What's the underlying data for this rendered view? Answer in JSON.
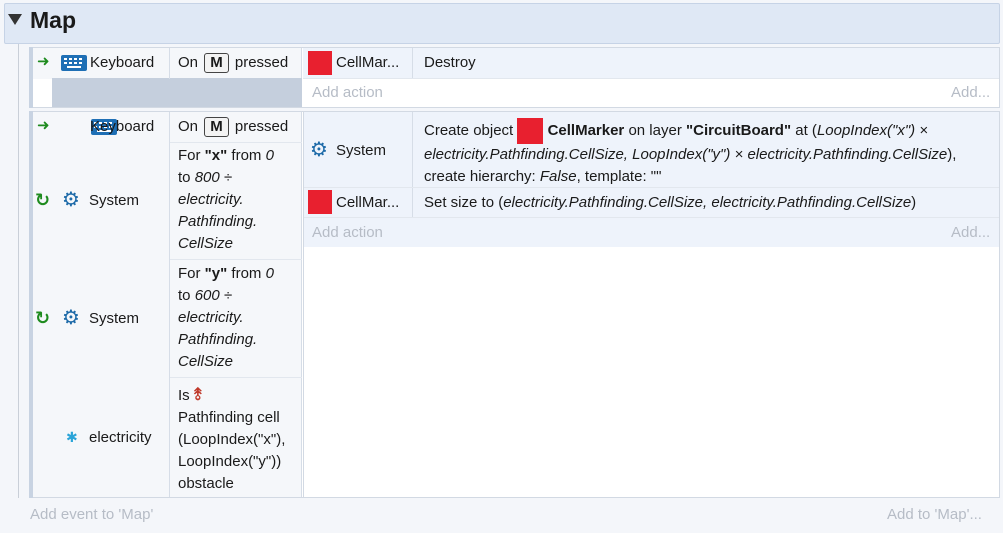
{
  "group": {
    "title": "Map"
  },
  "event1": {
    "condition": {
      "object": "Keyboard",
      "text_on": "On",
      "key": "M",
      "text_pressed": "pressed"
    },
    "action": {
      "object": "CellMar...",
      "text": "Destroy"
    },
    "add_action": "Add action",
    "add_more": "Add..."
  },
  "event2": {
    "condition": {
      "object": "Keyboard",
      "text_on": "On",
      "key": "M",
      "text_pressed": "pressed"
    },
    "action1": {
      "object": "System",
      "p1": "Create object",
      "obj_name": "CellMarker",
      "p2": "on layer",
      "layer": "\"CircuitBoard\"",
      "p3": "at (",
      "expr1": "LoopIndex(\"x\") × electricity.Pathfinding.CellSize, LoopIndex(\"y\") × electricity.Pathfinding.CellSize",
      "p4": "),",
      "p5": "create hierarchy:",
      "hier": "False",
      "p6": ", template: \"\""
    },
    "action2": {
      "object": "CellMar...",
      "p1": "Set size to (",
      "expr": "electricity.Pathfinding.CellSize, electricity.Pathfinding.CellSize",
      "p2": ")"
    },
    "add_action": "Add action",
    "add_more": "Add..."
  },
  "sub1": {
    "object": "System",
    "l1a": "For",
    "var": "\"x\"",
    "l1b": "from",
    "from": "0",
    "l2a": "to",
    "to": "800 ÷",
    "l3": "electricity.",
    "l4": "Pathfinding.",
    "l5": "CellSize"
  },
  "sub2": {
    "object": "System",
    "l1a": "For",
    "var": "\"y\"",
    "l1b": "from",
    "from": "0",
    "l2a": "to",
    "to": "600 ÷",
    "l3": "electricity.",
    "l4": "Pathfinding.",
    "l5": "CellSize"
  },
  "sub3": {
    "object": "electricity",
    "l1": "Is",
    "l2": "Pathfinding cell",
    "l3": "(LoopIndex(\"x\"),",
    "l4": "LoopIndex(\"y\"))",
    "l5": "obstacle"
  },
  "footer": {
    "add_event": "Add event to 'Map'",
    "add_to": "Add to 'Map'..."
  },
  "colors": {
    "accent_green": "#1e8b1e",
    "accent_blue": "#1e6fb5",
    "object_red": "#e8202f"
  }
}
